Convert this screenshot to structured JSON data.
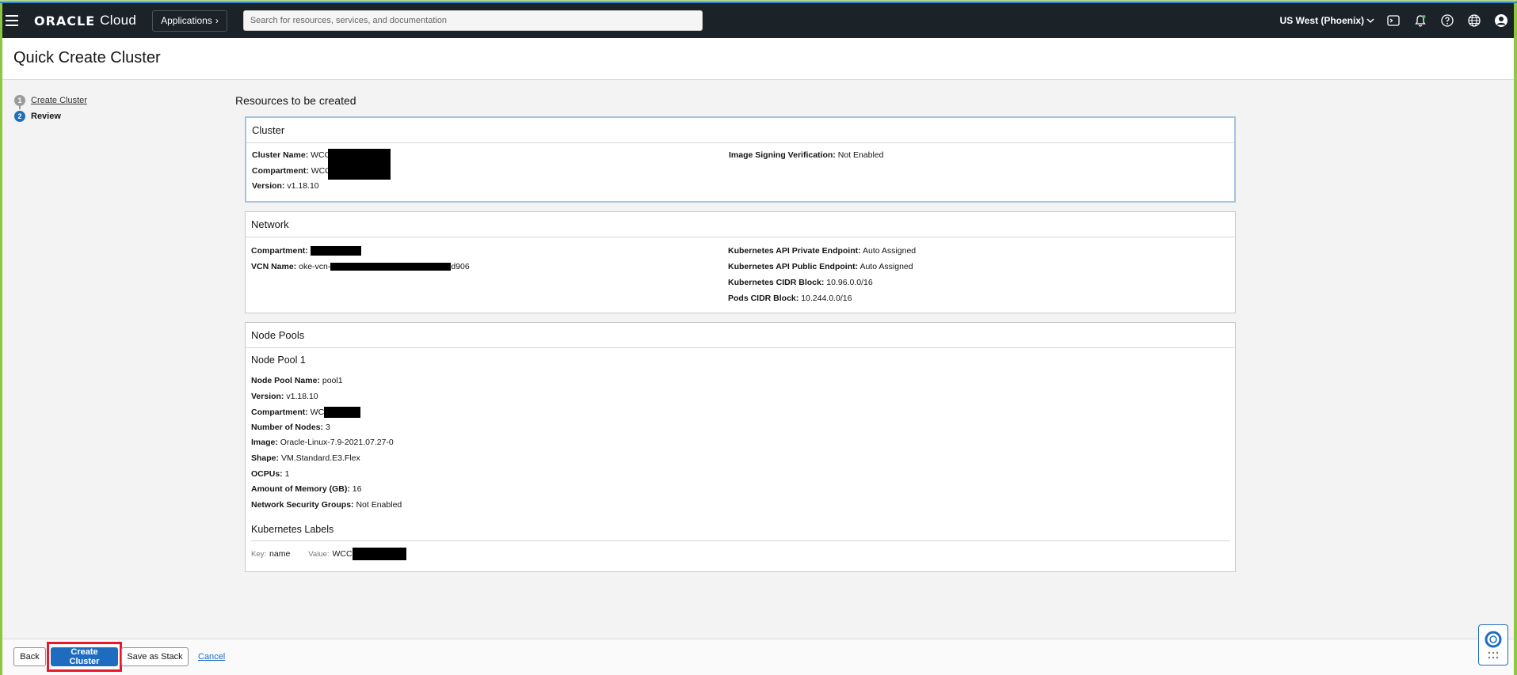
{
  "topbar": {
    "brand_oracle": "ORACLE",
    "brand_cloud": "Cloud",
    "applications_label": "Applications",
    "search_placeholder": "Search for resources, services, and documentation",
    "region": "US West (Phoenix)"
  },
  "page": {
    "title": "Quick Create Cluster"
  },
  "steps": [
    {
      "number": "1",
      "label": "Create Cluster"
    },
    {
      "number": "2",
      "label": "Review"
    }
  ],
  "review": {
    "heading": "Resources to be created",
    "cluster": {
      "title": "Cluster",
      "name_label": "Cluster Name:",
      "name_value": "WCC",
      "compartment_label": "Compartment:",
      "compartment_value": "WCC",
      "version_label": "Version:",
      "version_value": "v1.18.10",
      "image_signing_label": "Image Signing Verification:",
      "image_signing_value": "Not Enabled"
    },
    "network": {
      "title": "Network",
      "compartment_label": "Compartment:",
      "vcn_label": "VCN Name:",
      "vcn_prefix": "oke-vcn-",
      "vcn_suffix": "d906",
      "private_endpoint_label": "Kubernetes API Private Endpoint:",
      "private_endpoint_value": "Auto Assigned",
      "public_endpoint_label": "Kubernetes API Public Endpoint:",
      "public_endpoint_value": "Auto Assigned",
      "cidr_label": "Kubernetes CIDR Block:",
      "cidr_value": "10.96.0.0/16",
      "pods_cidr_label": "Pods CIDR Block:",
      "pods_cidr_value": "10.244.0.0/16"
    },
    "node_pools": {
      "title": "Node Pools",
      "pool_title": "Node Pool 1",
      "fields": [
        {
          "label": "Node Pool Name:",
          "value": "pool1"
        },
        {
          "label": "Version:",
          "value": "v1.18.10"
        },
        {
          "label": "Compartment:",
          "value": "WC"
        },
        {
          "label": "Number of Nodes:",
          "value": "3"
        },
        {
          "label": "Image:",
          "value": "Oracle-Linux-7.9-2021.07.27-0"
        },
        {
          "label": "Shape:",
          "value": "VM.Standard.E3.Flex"
        },
        {
          "label": "OCPUs:",
          "value": "1"
        },
        {
          "label": "Amount of Memory (GB):",
          "value": "16"
        },
        {
          "label": "Network Security Groups:",
          "value": "Not Enabled"
        }
      ],
      "labels_title": "Kubernetes Labels",
      "key_label": "Key:",
      "key_value": "name",
      "value_label": "Value:",
      "value_value": "WCC"
    }
  },
  "actions": {
    "back": "Back",
    "create": "Create Cluster",
    "save_stack": "Save as Stack",
    "cancel": "Cancel"
  },
  "colors": {
    "topbar": "#1b2329",
    "primary": "#1e6cc0",
    "highlight": "#e8192c",
    "frame": "#8dc63f"
  }
}
